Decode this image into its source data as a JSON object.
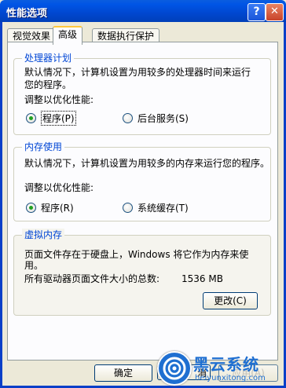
{
  "window": {
    "title": "性能选项",
    "help_label": "?",
    "close_label": "✕"
  },
  "tabs": [
    {
      "label": "视觉效果"
    },
    {
      "label": "高级"
    },
    {
      "label": "数据执行保护"
    }
  ],
  "processor_group": {
    "title": "处理器计划",
    "description_line1": "默认情况下，计算机设置为用较多的处理器时间来运行",
    "description_line2": "您的程序。",
    "adjust_label": "调整以优化性能:",
    "option_programs": "程序(P)",
    "option_background": "后台服务(S)",
    "selected": "程序(P)"
  },
  "memory_group": {
    "title": "内存使用",
    "description": "默认情况下，计算机设置为用较多的内存来运行您的程序。",
    "adjust_label": "调整以优化性能:",
    "option_programs": "程序(R)",
    "option_cache": "系统缓存(T)",
    "selected": "程序(R)"
  },
  "virtual_memory_group": {
    "title": "虚拟内存",
    "description_line1": "页面文件存在于硬盘上，Windows 将它作为内存来使",
    "description_line2": "用。",
    "total_label": "所有驱动器页面文件大小的总数:",
    "total_value": "1536 MB",
    "change_button": "更改(C)"
  },
  "footer": {
    "ok_button": "确定",
    "cancel_button_partial": "消",
    "apply_button": "应用(A)"
  },
  "watermark": {
    "brand": "黑云系统",
    "url": "heiyunxitong.com"
  }
}
